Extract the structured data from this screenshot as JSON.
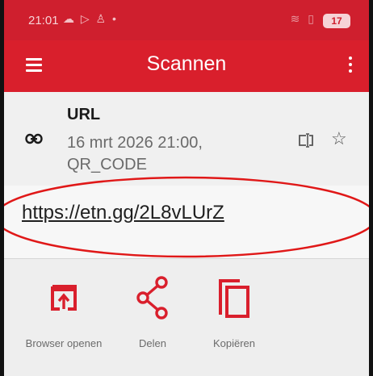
{
  "status_bar": {
    "time": "21:01",
    "left_icons": "☁ ▷ ♙ •",
    "right_icons": "≋ ▯",
    "battery": "17"
  },
  "app_bar": {
    "title": "Scannen"
  },
  "result": {
    "type": "URL",
    "meta": "16 mrt 2026 21:00, QR_CODE",
    "url": "https://etn.gg/2L8vLUrZ"
  },
  "actions": [
    {
      "label": "Browser openen",
      "icon": "open-in-browser-icon"
    },
    {
      "label": "Delen",
      "icon": "share-icon"
    },
    {
      "label": "Kopiëren",
      "icon": "copy-icon"
    }
  ],
  "colors": {
    "status_bar": "#cf1f2e",
    "app_bar": "#d91f2c",
    "accent": "#d91f2c",
    "annotation": "#e01818"
  }
}
